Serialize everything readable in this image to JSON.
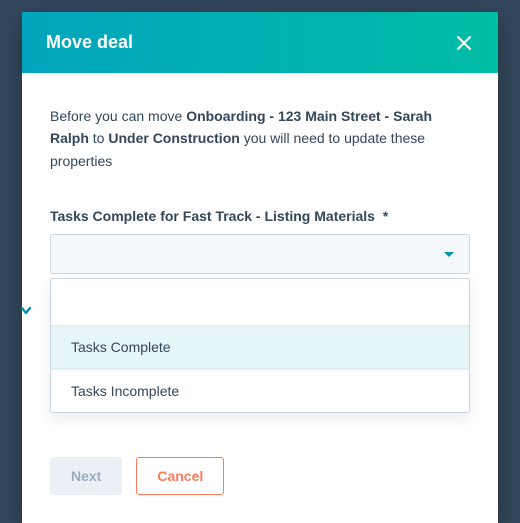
{
  "modal": {
    "title": "Move deal",
    "intro": {
      "prefix": "Before you can move ",
      "deal_name": "Onboarding - 123 Main Street - Sarah Ralph",
      "middle": " to ",
      "target_stage": "Under Construction",
      "suffix": " you will need to update these properties"
    },
    "field": {
      "label": "Tasks Complete for Fast Track - Listing Materials",
      "required_mark": "*",
      "options": [
        {
          "label": "Tasks Complete",
          "highlighted": true
        },
        {
          "label": "Tasks Incomplete",
          "highlighted": false
        }
      ]
    },
    "actions": {
      "next": "Next",
      "cancel": "Cancel"
    }
  }
}
